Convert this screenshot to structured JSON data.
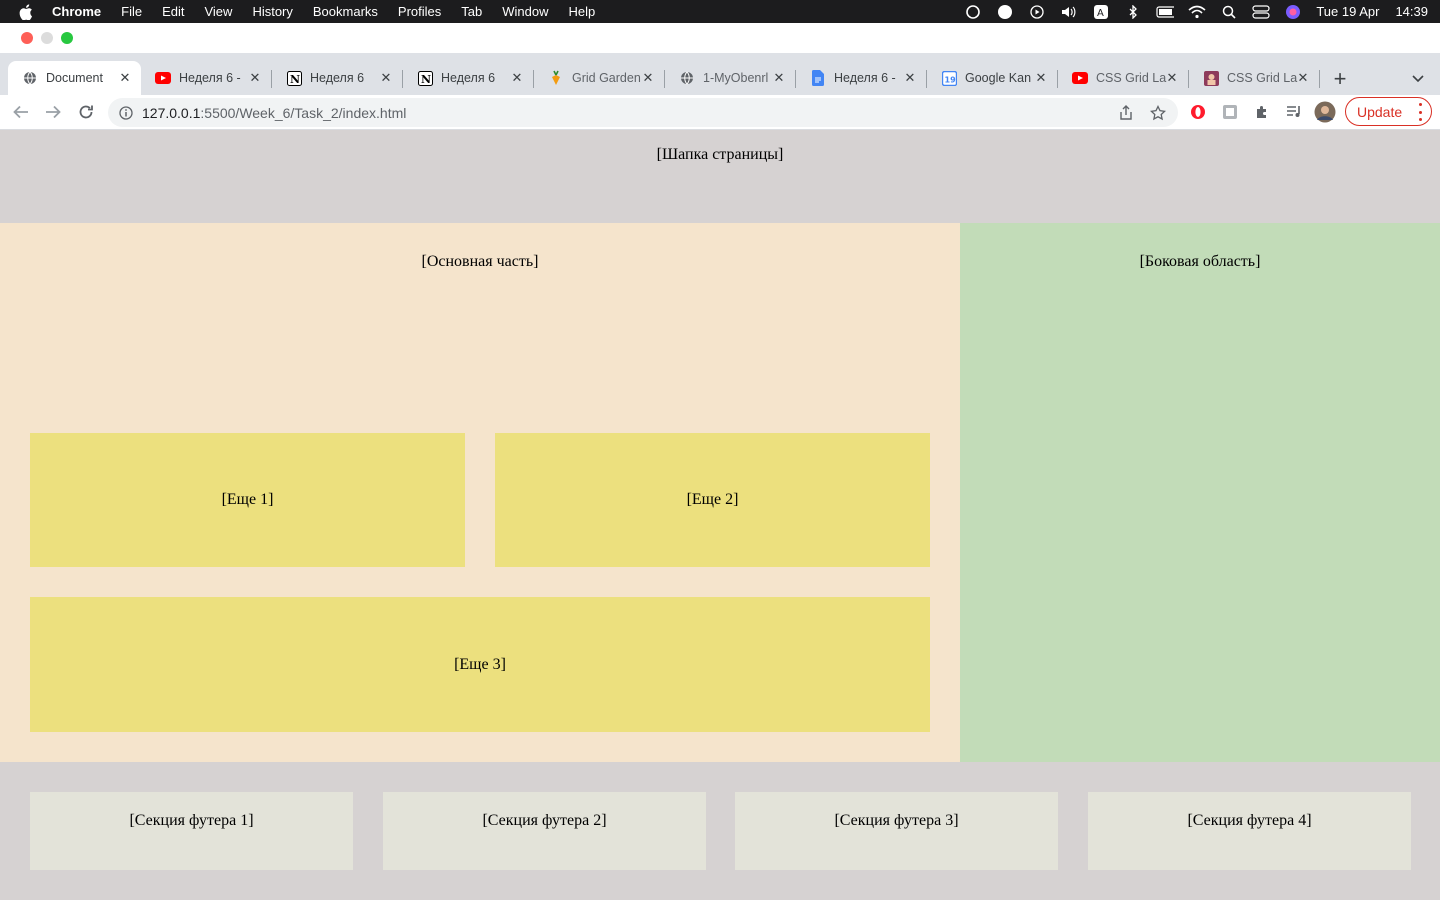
{
  "menubar": {
    "app_name": "Chrome",
    "items": [
      "File",
      "Edit",
      "View",
      "History",
      "Bookmarks",
      "Profiles",
      "Tab",
      "Window",
      "Help"
    ],
    "date": "Tue 19 Apr",
    "time": "14:39"
  },
  "tabs": [
    {
      "title": "Document",
      "icon": "globe-icon",
      "active": true
    },
    {
      "title": "Неделя 6 -",
      "icon": "youtube-icon"
    },
    {
      "title": "Неделя 6",
      "icon": "notion-icon"
    },
    {
      "title": "Неделя 6",
      "icon": "notion-icon"
    },
    {
      "title": "Grid Garden",
      "icon": "carrot-icon"
    },
    {
      "title": "1-MyObenrl",
      "icon": "globe-icon"
    },
    {
      "title": "Неделя 6 -",
      "icon": "google-docs-icon"
    },
    {
      "title": "Google Kan",
      "icon": "google-calendar-icon"
    },
    {
      "title": "CSS Grid La",
      "icon": "youtube-icon"
    },
    {
      "title": "CSS Grid La",
      "icon": "site-icon"
    }
  ],
  "toolbar": {
    "url_host": "127.0.0.1",
    "url_path": ":5500/Week_6/Task_2/index.html",
    "update_label": "Update"
  },
  "page": {
    "header": "[Шапка страницы]",
    "main": "[Основная часть]",
    "sidebar": "[Боковая область]",
    "more": [
      "[Еще 1]",
      "[Еще 2]",
      "[Еще 3]"
    ],
    "footer_sections": [
      "[Секция футера 1]",
      "[Секция футера 2]",
      "[Секция футера 3]",
      "[Секция футера 4]"
    ]
  },
  "colors": {
    "header_bg": "#d6d2d2",
    "main_bg": "#f5e4cc",
    "sidebar_bg": "#c2dcb8",
    "more_bg": "#ece07e",
    "footer_section_bg": "#e3e3d9",
    "update_accent": "#d93025"
  }
}
